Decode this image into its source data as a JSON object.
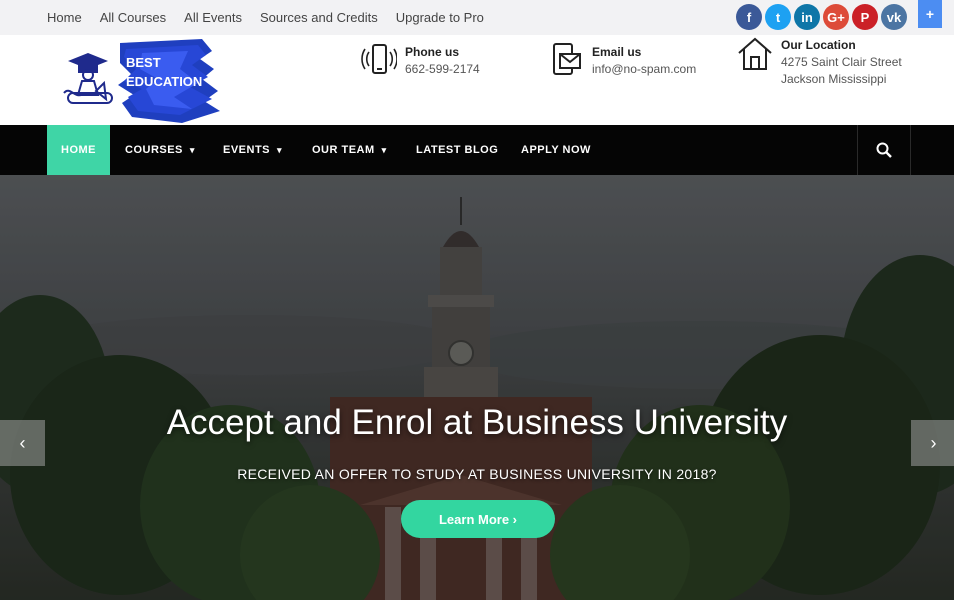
{
  "topbar": {
    "links": [
      "Home",
      "All Courses",
      "All Events",
      "Sources and Credits",
      "Upgrade to Pro"
    ],
    "socials": [
      {
        "name": "facebook-icon",
        "glyph": "f",
        "color": "#3b5998"
      },
      {
        "name": "twitter-icon",
        "glyph": "t",
        "color": "#1da1f2"
      },
      {
        "name": "linkedin-icon",
        "glyph": "in",
        "color": "#0e76a8"
      },
      {
        "name": "googleplus-icon",
        "glyph": "G+",
        "color": "#dd4b39"
      },
      {
        "name": "pinterest-icon",
        "glyph": "P",
        "color": "#cb2027"
      },
      {
        "name": "vk-icon",
        "glyph": "vk",
        "color": "#4c75a3"
      }
    ],
    "plus_label": "+"
  },
  "logo": {
    "line1": "BEST",
    "line2": "EDUCATION"
  },
  "contacts": {
    "phone": {
      "title": "Phone us",
      "line1": "662-599-2174"
    },
    "email": {
      "title": "Email us",
      "line1": "info@no-spam.com"
    },
    "location": {
      "title": "Our Location",
      "line1": "4275 Saint Clair Street",
      "line2": "Jackson Mississippi"
    }
  },
  "nav": {
    "items": [
      "HOME",
      "COURSES",
      "EVENTS",
      "OUR TEAM",
      "LATEST BLOG",
      "APPLY NOW"
    ],
    "caret": "⌄",
    "accent": "#3fd5a6"
  },
  "hero": {
    "title": "Accept and Enrol at Business University",
    "subtitle": "RECEIVED AN OFFER TO STUDY AT BUSINESS UNIVERSITY IN 2018?",
    "cta": "Learn More ›",
    "prev": "‹",
    "next": "›"
  }
}
